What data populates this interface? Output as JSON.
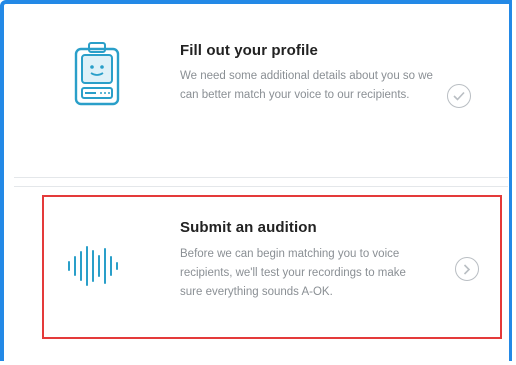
{
  "profile_card": {
    "title": "Fill out your profile",
    "description": "We need some additional details about you so we can better match your voice to our recipients.",
    "status_icon": "checkmark-circle-icon"
  },
  "audition_card": {
    "title": "Submit an audition",
    "description": "Before we can begin matching you to voice recipients, we'll test your recordings to make sure everything sounds A-OK.",
    "action_icon": "chevron-right-circle-icon"
  },
  "colors": {
    "accent_blue": "#2389e6",
    "icon_teal": "#2a9fc9",
    "highlight_red": "#e43a3a"
  }
}
